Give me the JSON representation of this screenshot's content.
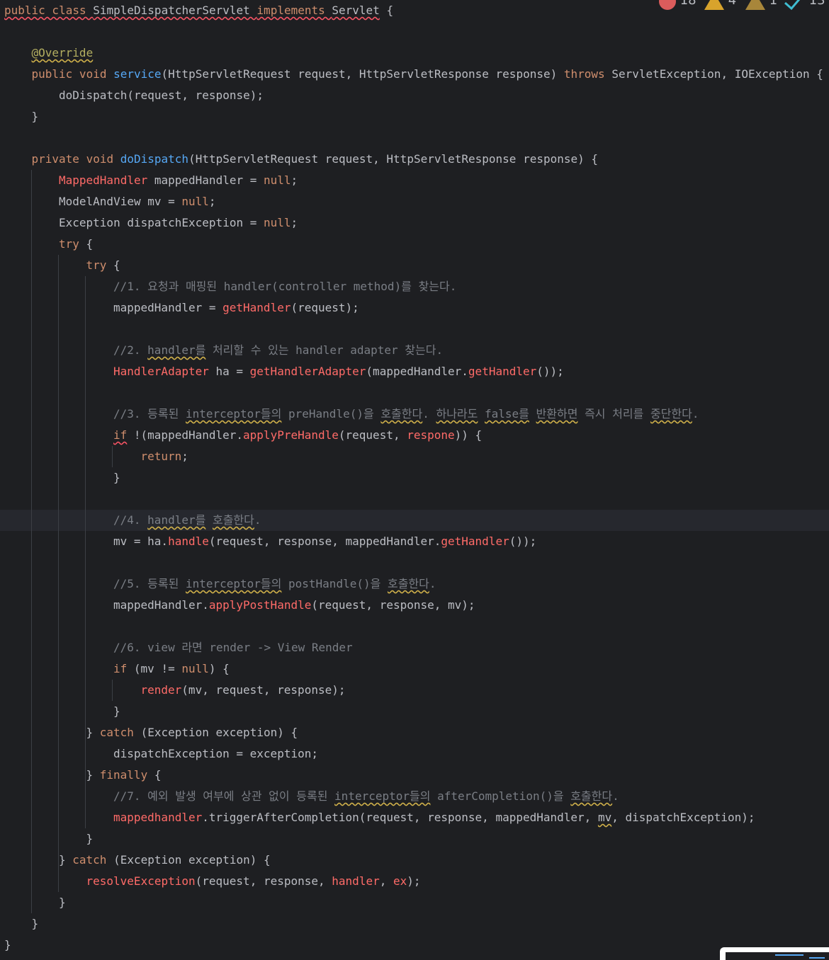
{
  "editor": {
    "lines": [
      {
        "tokens": [
          [
            "public class ",
            "kw wavy-red"
          ],
          [
            "SimpleDispatcherServlet ",
            "plain wavy-red"
          ],
          [
            "implements ",
            "kw wavy-red"
          ],
          [
            "Servlet",
            "plain wavy-red"
          ],
          [
            " {",
            "plain"
          ]
        ]
      },
      {
        "tokens": []
      },
      {
        "tokens": [
          [
            "@Override",
            "ann wavy"
          ]
        ]
      },
      {
        "tokens": [
          [
            "public void ",
            "kw"
          ],
          [
            "service",
            "fn"
          ],
          [
            "(HttpServletRequest request, HttpServletResponse response) ",
            "plain"
          ],
          [
            "throws ",
            "kw"
          ],
          [
            "ServletException, IOException {",
            "plain"
          ]
        ]
      },
      {
        "tokens": [
          [
            "doDispatch(request, response);",
            "plain"
          ]
        ]
      },
      {
        "tokens": [
          [
            "}",
            "plain"
          ]
        ]
      },
      {
        "tokens": []
      },
      {
        "tokens": [
          [
            "private void ",
            "kw"
          ],
          [
            "doDispatch",
            "fn"
          ],
          [
            "(HttpServletRequest request, HttpServletResponse response) {",
            "plain"
          ]
        ]
      },
      {
        "tokens": [
          [
            "MappedHandler",
            "red"
          ],
          [
            " mappedHandler = ",
            "plain"
          ],
          [
            "null",
            "kw"
          ],
          [
            ";",
            "plain"
          ]
        ]
      },
      {
        "tokens": [
          [
            "ModelAndView mv = ",
            "plain"
          ],
          [
            "null",
            "kw"
          ],
          [
            ";",
            "plain"
          ]
        ]
      },
      {
        "tokens": [
          [
            "Exception dispatchException = ",
            "plain"
          ],
          [
            "null",
            "kw"
          ],
          [
            ";",
            "plain"
          ]
        ]
      },
      {
        "tokens": [
          [
            "try ",
            "kw"
          ],
          [
            "{",
            "plain"
          ]
        ]
      },
      {
        "tokens": [
          [
            "try ",
            "kw"
          ],
          [
            "{",
            "plain"
          ]
        ]
      },
      {
        "tokens": [
          [
            "//1. 요청과 매핑된 handler(controller method)를 찾는다.",
            "cm"
          ]
        ]
      },
      {
        "tokens": [
          [
            "mappedHandler = ",
            "plain"
          ],
          [
            "getHandler",
            "red"
          ],
          [
            "(request);",
            "plain"
          ]
        ]
      },
      {
        "tokens": []
      },
      {
        "tokens": [
          [
            "//2. ",
            "cm"
          ],
          [
            "handler를",
            "cm wavy"
          ],
          [
            " 처리할 수 있는 handler adapter 찾는다.",
            "cm"
          ]
        ]
      },
      {
        "tokens": [
          [
            "HandlerAdapter",
            "red"
          ],
          [
            " ha = ",
            "plain"
          ],
          [
            "getHandlerAdapter",
            "red"
          ],
          [
            "(mappedHandler.",
            "plain"
          ],
          [
            "getHandler",
            "red"
          ],
          [
            "());",
            "plain"
          ]
        ]
      },
      {
        "tokens": []
      },
      {
        "tokens": [
          [
            "//3. 등록된 ",
            "cm"
          ],
          [
            "interceptor들의",
            "cm wavy"
          ],
          [
            " preHandle()을 ",
            "cm"
          ],
          [
            "호출한다",
            "cm wavy"
          ],
          [
            ". ",
            "cm"
          ],
          [
            "하나라도",
            "cm wavy"
          ],
          [
            " ",
            "cm"
          ],
          [
            "false를",
            "cm wavy"
          ],
          [
            " ",
            "cm"
          ],
          [
            "반환하면",
            "cm wavy"
          ],
          [
            " 즉시 처리를 ",
            "cm"
          ],
          [
            "중단한다",
            "cm wavy"
          ],
          [
            ".",
            "cm"
          ]
        ]
      },
      {
        "tokens": [
          [
            "if",
            "kw wavy-red"
          ],
          [
            " !(mappedHandler.",
            "plain"
          ],
          [
            "applyPreHandle",
            "red"
          ],
          [
            "(request, ",
            "plain"
          ],
          [
            "respone",
            "red"
          ],
          [
            ")) {",
            "plain"
          ]
        ]
      },
      {
        "tokens": [
          [
            "return",
            "kw"
          ],
          [
            ";",
            "plain"
          ]
        ]
      },
      {
        "tokens": [
          [
            "}",
            "plain"
          ]
        ]
      },
      {
        "tokens": []
      },
      {
        "tokens": [
          [
            "//4. ",
            "cm"
          ],
          [
            "handler를",
            "cm wavy"
          ],
          [
            " ",
            "cm"
          ],
          [
            "호출한다",
            "cm wavy"
          ],
          [
            ".",
            "cm"
          ]
        ]
      },
      {
        "tokens": [
          [
            "mv = ha.",
            "plain"
          ],
          [
            "handle",
            "red"
          ],
          [
            "(request, response, mappedHandler.",
            "plain"
          ],
          [
            "getHandler",
            "red"
          ],
          [
            "());",
            "plain"
          ]
        ]
      },
      {
        "tokens": []
      },
      {
        "tokens": [
          [
            "//5. 등록된 ",
            "cm"
          ],
          [
            "interceptor들의",
            "cm wavy"
          ],
          [
            " postHandle()을 ",
            "cm"
          ],
          [
            "호출한다",
            "cm wavy"
          ],
          [
            ".",
            "cm"
          ]
        ]
      },
      {
        "tokens": [
          [
            "mappedHandler.",
            "plain"
          ],
          [
            "applyPostHandle",
            "red"
          ],
          [
            "(request, response, mv);",
            "plain"
          ]
        ]
      },
      {
        "tokens": []
      },
      {
        "tokens": [
          [
            "//6. view 라면 render -> View Render",
            "cm"
          ]
        ]
      },
      {
        "tokens": [
          [
            "if ",
            "kw"
          ],
          [
            "(mv != ",
            "plain"
          ],
          [
            "null",
            "kw"
          ],
          [
            ") {",
            "plain"
          ]
        ]
      },
      {
        "tokens": [
          [
            "render",
            "red"
          ],
          [
            "(mv, request, response);",
            "plain"
          ]
        ]
      },
      {
        "tokens": [
          [
            "}",
            "plain"
          ]
        ]
      },
      {
        "tokens": [
          [
            "} ",
            "plain"
          ],
          [
            "catch ",
            "kw"
          ],
          [
            "(Exception exception) {",
            "plain"
          ]
        ]
      },
      {
        "tokens": [
          [
            "dispatchException = exception;",
            "plain"
          ]
        ]
      },
      {
        "tokens": [
          [
            "} ",
            "plain"
          ],
          [
            "finally ",
            "kw"
          ],
          [
            "{",
            "plain"
          ]
        ]
      },
      {
        "tokens": [
          [
            "//7. 예외 발생 여부에 상관 없이 등록된 ",
            "cm"
          ],
          [
            "interceptor들의",
            "cm wavy"
          ],
          [
            " afterCompletion()을 ",
            "cm"
          ],
          [
            "호출한다",
            "cm wavy"
          ],
          [
            ".",
            "cm"
          ]
        ]
      },
      {
        "tokens": [
          [
            "mappedhandler",
            "red"
          ],
          [
            ".triggerAfterCompletion(request, response, mappedHandler, ",
            "plain"
          ],
          [
            "mv",
            "plain wavy"
          ],
          [
            ", dispatchException);",
            "plain"
          ]
        ]
      },
      {
        "tokens": [
          [
            "}",
            "plain"
          ]
        ]
      },
      {
        "tokens": [
          [
            "} ",
            "plain"
          ],
          [
            "catch ",
            "kw"
          ],
          [
            "(Exception exception) {",
            "plain"
          ]
        ]
      },
      {
        "tokens": [
          [
            "resolveException",
            "red"
          ],
          [
            "(request, response, ",
            "plain"
          ],
          [
            "handler",
            "red"
          ],
          [
            ", ",
            "plain"
          ],
          [
            "ex",
            "red"
          ],
          [
            ");",
            "plain"
          ]
        ]
      },
      {
        "tokens": [
          [
            "}",
            "plain"
          ]
        ]
      },
      {
        "tokens": [
          [
            "}",
            "plain"
          ]
        ]
      },
      {
        "tokens": [
          [
            "}",
            "plain"
          ]
        ]
      }
    ]
  },
  "inspections": {
    "errors": "18",
    "warnings": "4",
    "weak_warnings": "1",
    "typos": "13"
  },
  "colors": {
    "background": "#1e1f22",
    "keyword": "#cf8e6d",
    "function_decl": "#56a8f5",
    "annotation": "#b3ae60",
    "comment": "#7a7e85",
    "error": "#ff6b68"
  }
}
